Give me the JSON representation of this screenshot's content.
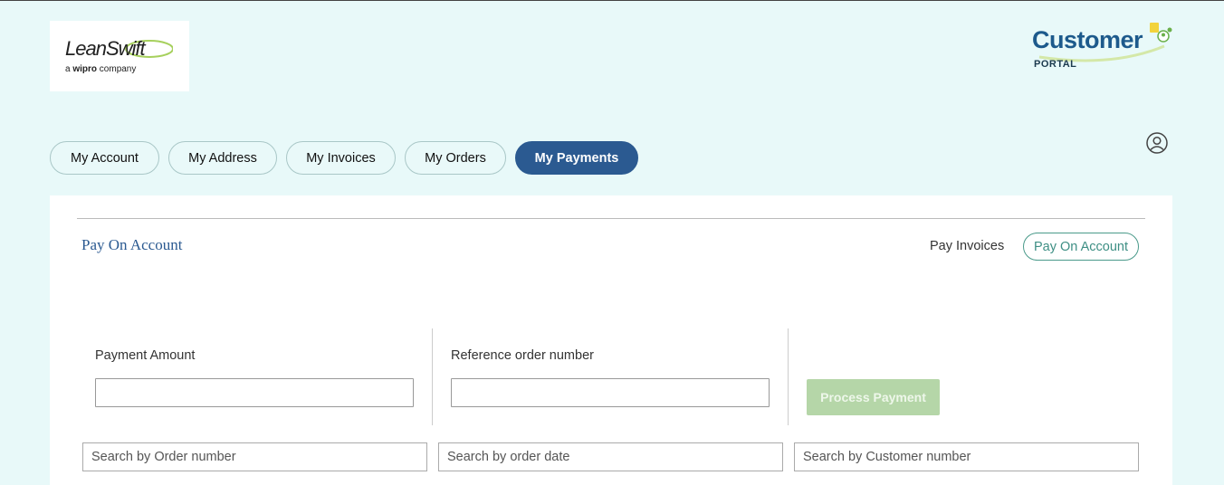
{
  "brand": {
    "left_logo": "LeanSwift",
    "left_logo_sub_prefix": "a",
    "left_logo_sub_bold": "wipro",
    "left_logo_sub_suffix": "company",
    "right_logo_title": "Customer",
    "right_logo_sub": "PORTAL"
  },
  "tabs": [
    {
      "label": "My Account",
      "active": false
    },
    {
      "label": "My Address",
      "active": false
    },
    {
      "label": "My Invoices",
      "active": false
    },
    {
      "label": "My Orders",
      "active": false
    },
    {
      "label": "My Payments",
      "active": true
    }
  ],
  "panel": {
    "title": "Pay On Account",
    "pay_invoices_label": "Pay Invoices",
    "pay_on_account_label": "Pay On Account"
  },
  "form": {
    "payment_amount_label": "Payment Amount",
    "payment_amount_value": "",
    "reference_label": "Reference order number",
    "reference_value": "",
    "process_button": "Process Payment"
  },
  "search": {
    "order_number_placeholder": "Search by Order number",
    "order_date_placeholder": "Search by order date",
    "customer_number_placeholder": "Search by Customer number"
  },
  "colors": {
    "page_bg": "#e8f9f9",
    "accent": "#2b5a91",
    "process_button_bg": "#b5d6a8"
  }
}
